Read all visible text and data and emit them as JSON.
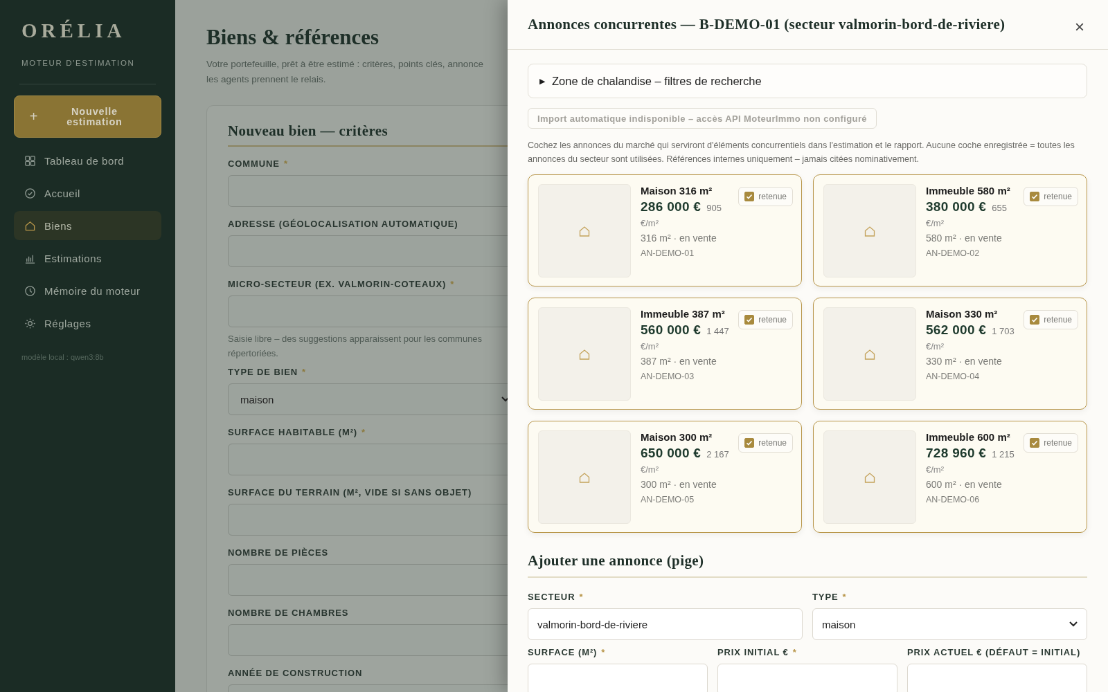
{
  "sidebar": {
    "logo": "ORÉLIA",
    "subtitle": "MOTEUR D'ESTIMATION",
    "new_button": {
      "icon_text": "+",
      "label": "Nouvelle estimation"
    },
    "items": [
      {
        "label": "Tableau de bord",
        "selected": false
      },
      {
        "label": "Accueil",
        "selected": false
      },
      {
        "label": "Biens",
        "selected": true
      },
      {
        "label": "Estimations",
        "selected": false
      },
      {
        "label": "Mémoire du moteur",
        "selected": false
      },
      {
        "label": "Réglages",
        "selected": false
      }
    ],
    "footer": "modèle local : qwen3:8b"
  },
  "page": {
    "title": "Biens & références",
    "intro_lines": [
      "Votre portefeuille, prêt à être estimé : critères, points clés, annonce",
      "les agents prennent le relais."
    ],
    "form": {
      "title": "Nouveau bien — critères",
      "required_mark": "*",
      "fields": [
        {
          "label": "COMMUNE",
          "required": true,
          "kind": "input"
        },
        {
          "label": "ADRESSE (GÉOLOCALISATION AUTOMATIQUE)",
          "required": false,
          "kind": "input"
        },
        {
          "label": "MICRO-SECTEUR (EX. VALMORIN-COTEAUX)",
          "required": true,
          "kind": "input",
          "hint": "Saisie libre – des suggestions apparaissent pour les communes répertoriées."
        },
        {
          "label": "TYPE DE BIEN",
          "required": true,
          "kind": "select",
          "value": "maison"
        },
        {
          "label": "SURFACE HABITABLE (M²)",
          "required": true,
          "kind": "input"
        },
        {
          "label": "SURFACE DU TERRAIN (M², VIDE SI SANS OBJET)",
          "required": false,
          "kind": "input"
        },
        {
          "label": "NOMBRE DE PIÈCES",
          "required": false,
          "kind": "input"
        },
        {
          "label": "NOMBRE DE CHAMBRES",
          "required": false,
          "kind": "input"
        },
        {
          "label": "ANNÉE DE CONSTRUCTION",
          "required": false,
          "kind": "input"
        }
      ]
    }
  },
  "drawer": {
    "title": "Annonces concurrentes — B-DEMO-01 (secteur valmorin-bord-de-riviere)",
    "close": "×",
    "filters": {
      "marker": "▶",
      "label": "Zone de chalandise – filtres de recherche",
      "expanded": false
    },
    "import_button": {
      "label": "Import automatique indisponible – accès API MoteurImmo non configuré",
      "disabled": true
    },
    "description": "Cochez les annonces du marché qui serviront d'éléments concurrentiels dans l'estimation et le rapport. Aucune coche enregistrée = toutes les annonces du secteur sont utilisées. Références internes uniquement – jamais citées nominativement.",
    "listings": [
      {
        "title": "Maison 316 m²",
        "price": "286 000 €",
        "price_per_m2": "905",
        "unit": "€/m²",
        "meta": "316 m² · en vente",
        "ref": "AN-DEMO-01",
        "check_label": "retenue",
        "checked": true
      },
      {
        "title": "Immeuble 580 m²",
        "price": "380 000 €",
        "price_per_m2": "655",
        "unit": "€/m²",
        "meta": "580 m² · en vente",
        "ref": "AN-DEMO-02",
        "check_label": "retenue",
        "checked": true
      },
      {
        "title": "Immeuble 387 m²",
        "price": "560 000 €",
        "price_per_m2": "1 447",
        "unit": "€/m²",
        "meta": "387 m² · en vente",
        "ref": "AN-DEMO-03",
        "check_label": "retenue",
        "checked": true
      },
      {
        "title": "Maison 330 m²",
        "price": "562 000 €",
        "price_per_m2": "1 703",
        "unit": "€/m²",
        "meta": "330 m² · en vente",
        "ref": "AN-DEMO-04",
        "check_label": "retenue",
        "checked": true
      },
      {
        "title": "Maison 300 m²",
        "price": "650 000 €",
        "price_per_m2": "2 167",
        "unit": "€/m²",
        "meta": "300 m² · en vente",
        "ref": "AN-DEMO-05",
        "check_label": "retenue",
        "checked": true
      },
      {
        "title": "Immeuble 600 m²",
        "price": "728 960 €",
        "price_per_m2": "1 215",
        "unit": "€/m²",
        "meta": "600 m² · en vente",
        "ref": "AN-DEMO-06",
        "check_label": "retenue",
        "checked": true
      }
    ],
    "add_form": {
      "title": "Ajouter une annonce (pige)",
      "required_mark": "*",
      "rows": [
        [
          {
            "label": "SECTEUR",
            "required": true,
            "kind": "input",
            "value": "valmorin-bord-de-riviere"
          },
          {
            "label": "TYPE",
            "required": true,
            "kind": "select",
            "value": "maison"
          }
        ],
        [
          {
            "label": "SURFACE (M²)",
            "required": true,
            "kind": "input"
          },
          {
            "label": "PRIX INITIAL €",
            "required": true,
            "kind": "input"
          },
          {
            "label": "PRIX ACTUEL € (DÉFAUT = INITIAL)",
            "required": false,
            "kind": "input"
          }
        ]
      ]
    }
  }
}
